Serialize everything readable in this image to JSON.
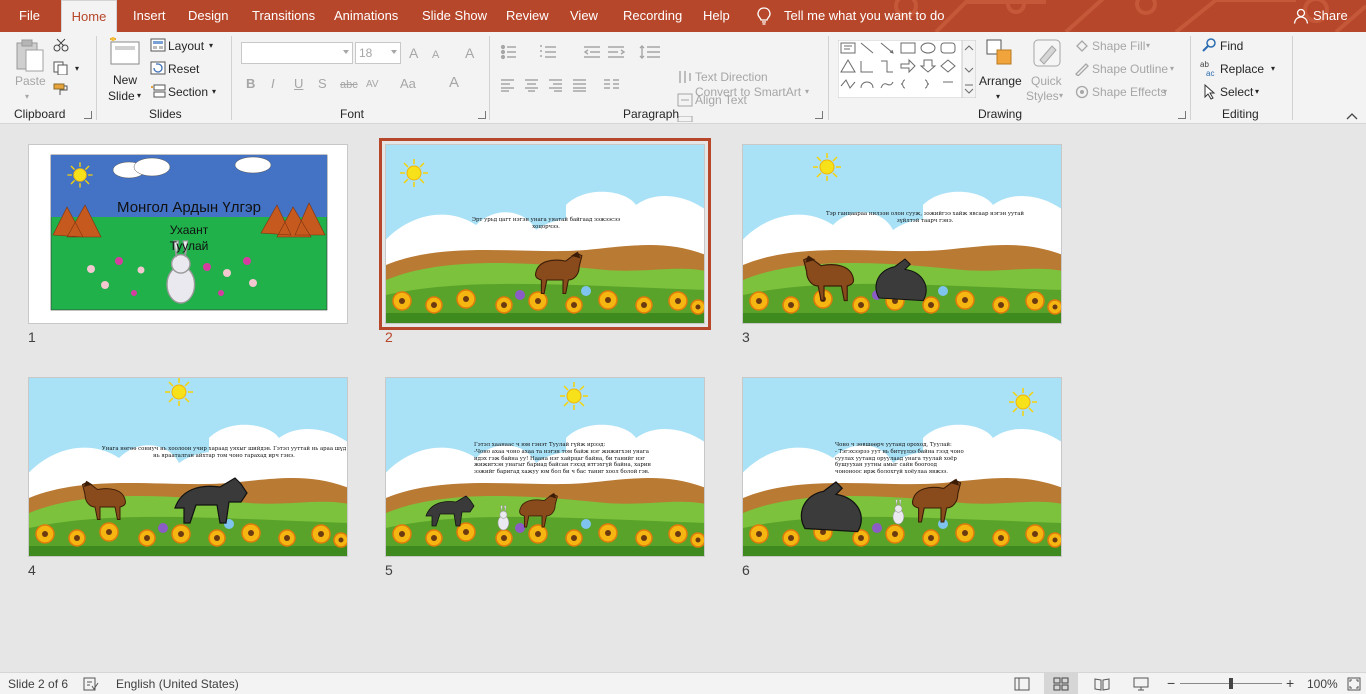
{
  "tabs": {
    "file": "File",
    "home": "Home",
    "insert": "Insert",
    "design": "Design",
    "transitions": "Transitions",
    "animations": "Animations",
    "slide_show": "Slide Show",
    "review": "Review",
    "view": "View",
    "recording": "Recording",
    "help": "Help",
    "tell_me": "Tell me what you want to do",
    "share": "Share"
  },
  "ribbon": {
    "clipboard": {
      "label": "Clipboard",
      "paste": "Paste"
    },
    "slides": {
      "label": "Slides",
      "new_slide_1": "New",
      "new_slide_2": "Slide",
      "layout": "Layout",
      "reset": "Reset",
      "section": "Section"
    },
    "font": {
      "label": "Font",
      "font_name": "",
      "font_size": "18",
      "bold": "B",
      "italic": "I",
      "underline": "U",
      "shadow": "S",
      "strike": "abc",
      "spacing": "AV",
      "case": "Aa",
      "grow": "A",
      "shrink": "A",
      "clear": "A",
      "color": "A"
    },
    "paragraph": {
      "label": "Paragraph",
      "text_direction": "Text Direction",
      "align_text": "Align Text",
      "convert_smartart": "Convert to SmartArt"
    },
    "drawing": {
      "label": "Drawing",
      "arrange": "Arrange",
      "quick_styles_1": "Quick",
      "quick_styles_2": "Styles",
      "shape_fill": "Shape Fill",
      "shape_outline": "Shape Outline",
      "shape_effects": "Shape Effects"
    },
    "editing": {
      "label": "Editing",
      "find": "Find",
      "replace": "Replace",
      "select": "Select"
    }
  },
  "slides": [
    {
      "number": "1",
      "title": "Монгол Ардын Үлгэр",
      "subtitle_1": "Ухаант",
      "subtitle_2": "Туулай"
    },
    {
      "number": "2",
      "text": "Эрт урьд цагт нэгэн унага уяатай байгаад ээжээсээ хоцорчээ."
    },
    {
      "number": "3",
      "text": "Тэр ганцаараа нилээн олон сууж, ээжийгээ хайж явсаар нэгэн уутай зүйлтэй таарч гэнэ."
    },
    {
      "number": "4",
      "text": "Унага нөгөө сониуч нь хоолоон учир хараад уяхыг шийдэв. Гэтэл ууттай нь араа шүд нь ярааталган айхтар том чоно гарахад ирч гэнэ."
    },
    {
      "number": "5",
      "text_1": "Гэтэл хаанаас ч юм гэнэт Туулай гүйж ирээд:",
      "text_2": "-Чоно ахаа чоно ахаа та нэгэн том байж нэг жижигхэн унага идэх гэж байна уу! Наана нэг хайрцаг байна, би танийг нэг жижигхэн унагыг бариад байсан гэхэд итгэхгүй байна, харин ээжийг баригад хажуу юм бол би ч бас таниг хоол болой гэв."
    },
    {
      "number": "6",
      "text_1": "Чоно ч зөвшөөрч уутанд ороход, Туулай:",
      "text_2": "- Тэгэхээрээ уут нь битүүлээ байна гээд чоно суулах уутанд оруулаад унага туулай хоёр бушуухан уутны амыг сайн боогоод чононоос ирж болохгүй хоёулаа явжээ."
    }
  ],
  "status": {
    "slide_info": "Slide 2 of 6",
    "language": "English (United States)",
    "zoom": "100%"
  },
  "colors": {
    "accent": "#b7472a",
    "ribbon_bg": "#f3f3f3",
    "canvas_bg": "#e6e6e6"
  }
}
